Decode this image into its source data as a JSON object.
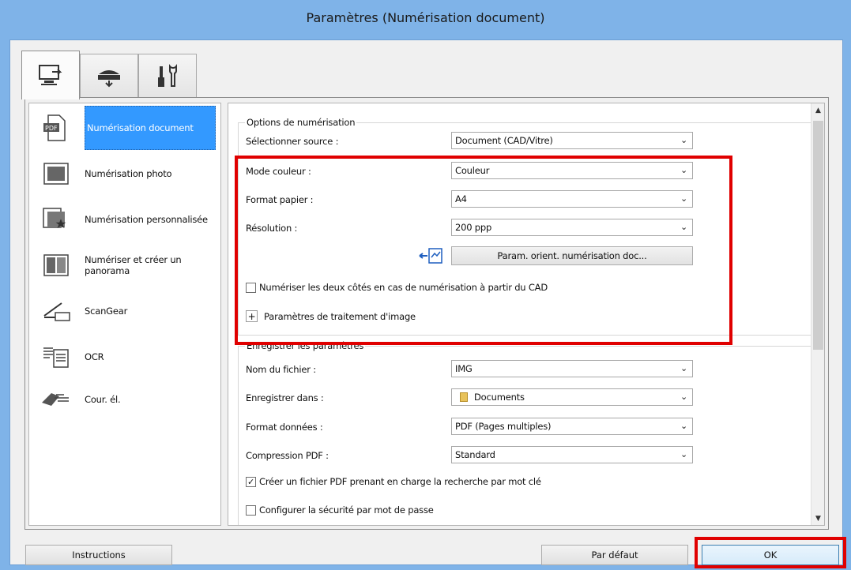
{
  "window": {
    "title": "Paramètres (Numérisation document)"
  },
  "tabs": [
    {
      "icon": "computer-scan-icon",
      "active": true
    },
    {
      "icon": "scanner-device-icon",
      "active": false
    },
    {
      "icon": "tools-icon",
      "active": false
    }
  ],
  "left_list": [
    {
      "label": "Numérisation document",
      "icon": "pdf-document-icon",
      "selected": true
    },
    {
      "label": "Numérisation photo",
      "icon": "photo-icon",
      "selected": false
    },
    {
      "label": "Numérisation personnalisée",
      "icon": "custom-scan-icon",
      "selected": false
    },
    {
      "label": "Numériser et créer un panorama",
      "icon": "panorama-icon",
      "selected": false
    },
    {
      "label": "ScanGear",
      "icon": "scangear-icon",
      "selected": false
    },
    {
      "label": "OCR",
      "icon": "ocr-icon",
      "selected": false
    },
    {
      "label": "Cour. él.",
      "icon": "email-icon",
      "selected": false
    }
  ],
  "scan_options": {
    "title": "Options de numérisation",
    "source": {
      "label": "Sélectionner source :",
      "value": "Document (CAD/Vitre)"
    },
    "color_mode": {
      "label": "Mode couleur :",
      "value": "Couleur"
    },
    "paper_size": {
      "label": "Format papier :",
      "value": "A4"
    },
    "resolution": {
      "label": "Résolution :",
      "value": "200 ppp"
    },
    "orientation_button": "Param. orient. numérisation doc...",
    "duplex_checkbox": {
      "label": "Numériser les deux côtés en cas de numérisation à partir du CAD",
      "checked": false
    },
    "image_processing": "Paramètres de traitement d'image"
  },
  "save_settings": {
    "title": "Enregistrer les paramètres",
    "file_name": {
      "label": "Nom du fichier :",
      "value": "IMG"
    },
    "save_in": {
      "label": "Enregistrer dans :",
      "value": "Documents"
    },
    "data_format": {
      "label": "Format données :",
      "value": "PDF (Pages multiples)"
    },
    "pdf_compression": {
      "label": "Compression PDF :",
      "value": "Standard"
    },
    "searchable_pdf": {
      "label": "Créer un fichier PDF prenant en charge la recherche par mot clé",
      "checked": true
    },
    "password_security": {
      "label": "Configurer la sécurité par mot de passe",
      "checked": false
    }
  },
  "footer": {
    "instructions": "Instructions",
    "defaults": "Par défaut",
    "ok": "OK"
  },
  "colors": {
    "titlebar": "#7fb3e8",
    "selection": "#3399ff",
    "highlight_box": "#e00000"
  }
}
